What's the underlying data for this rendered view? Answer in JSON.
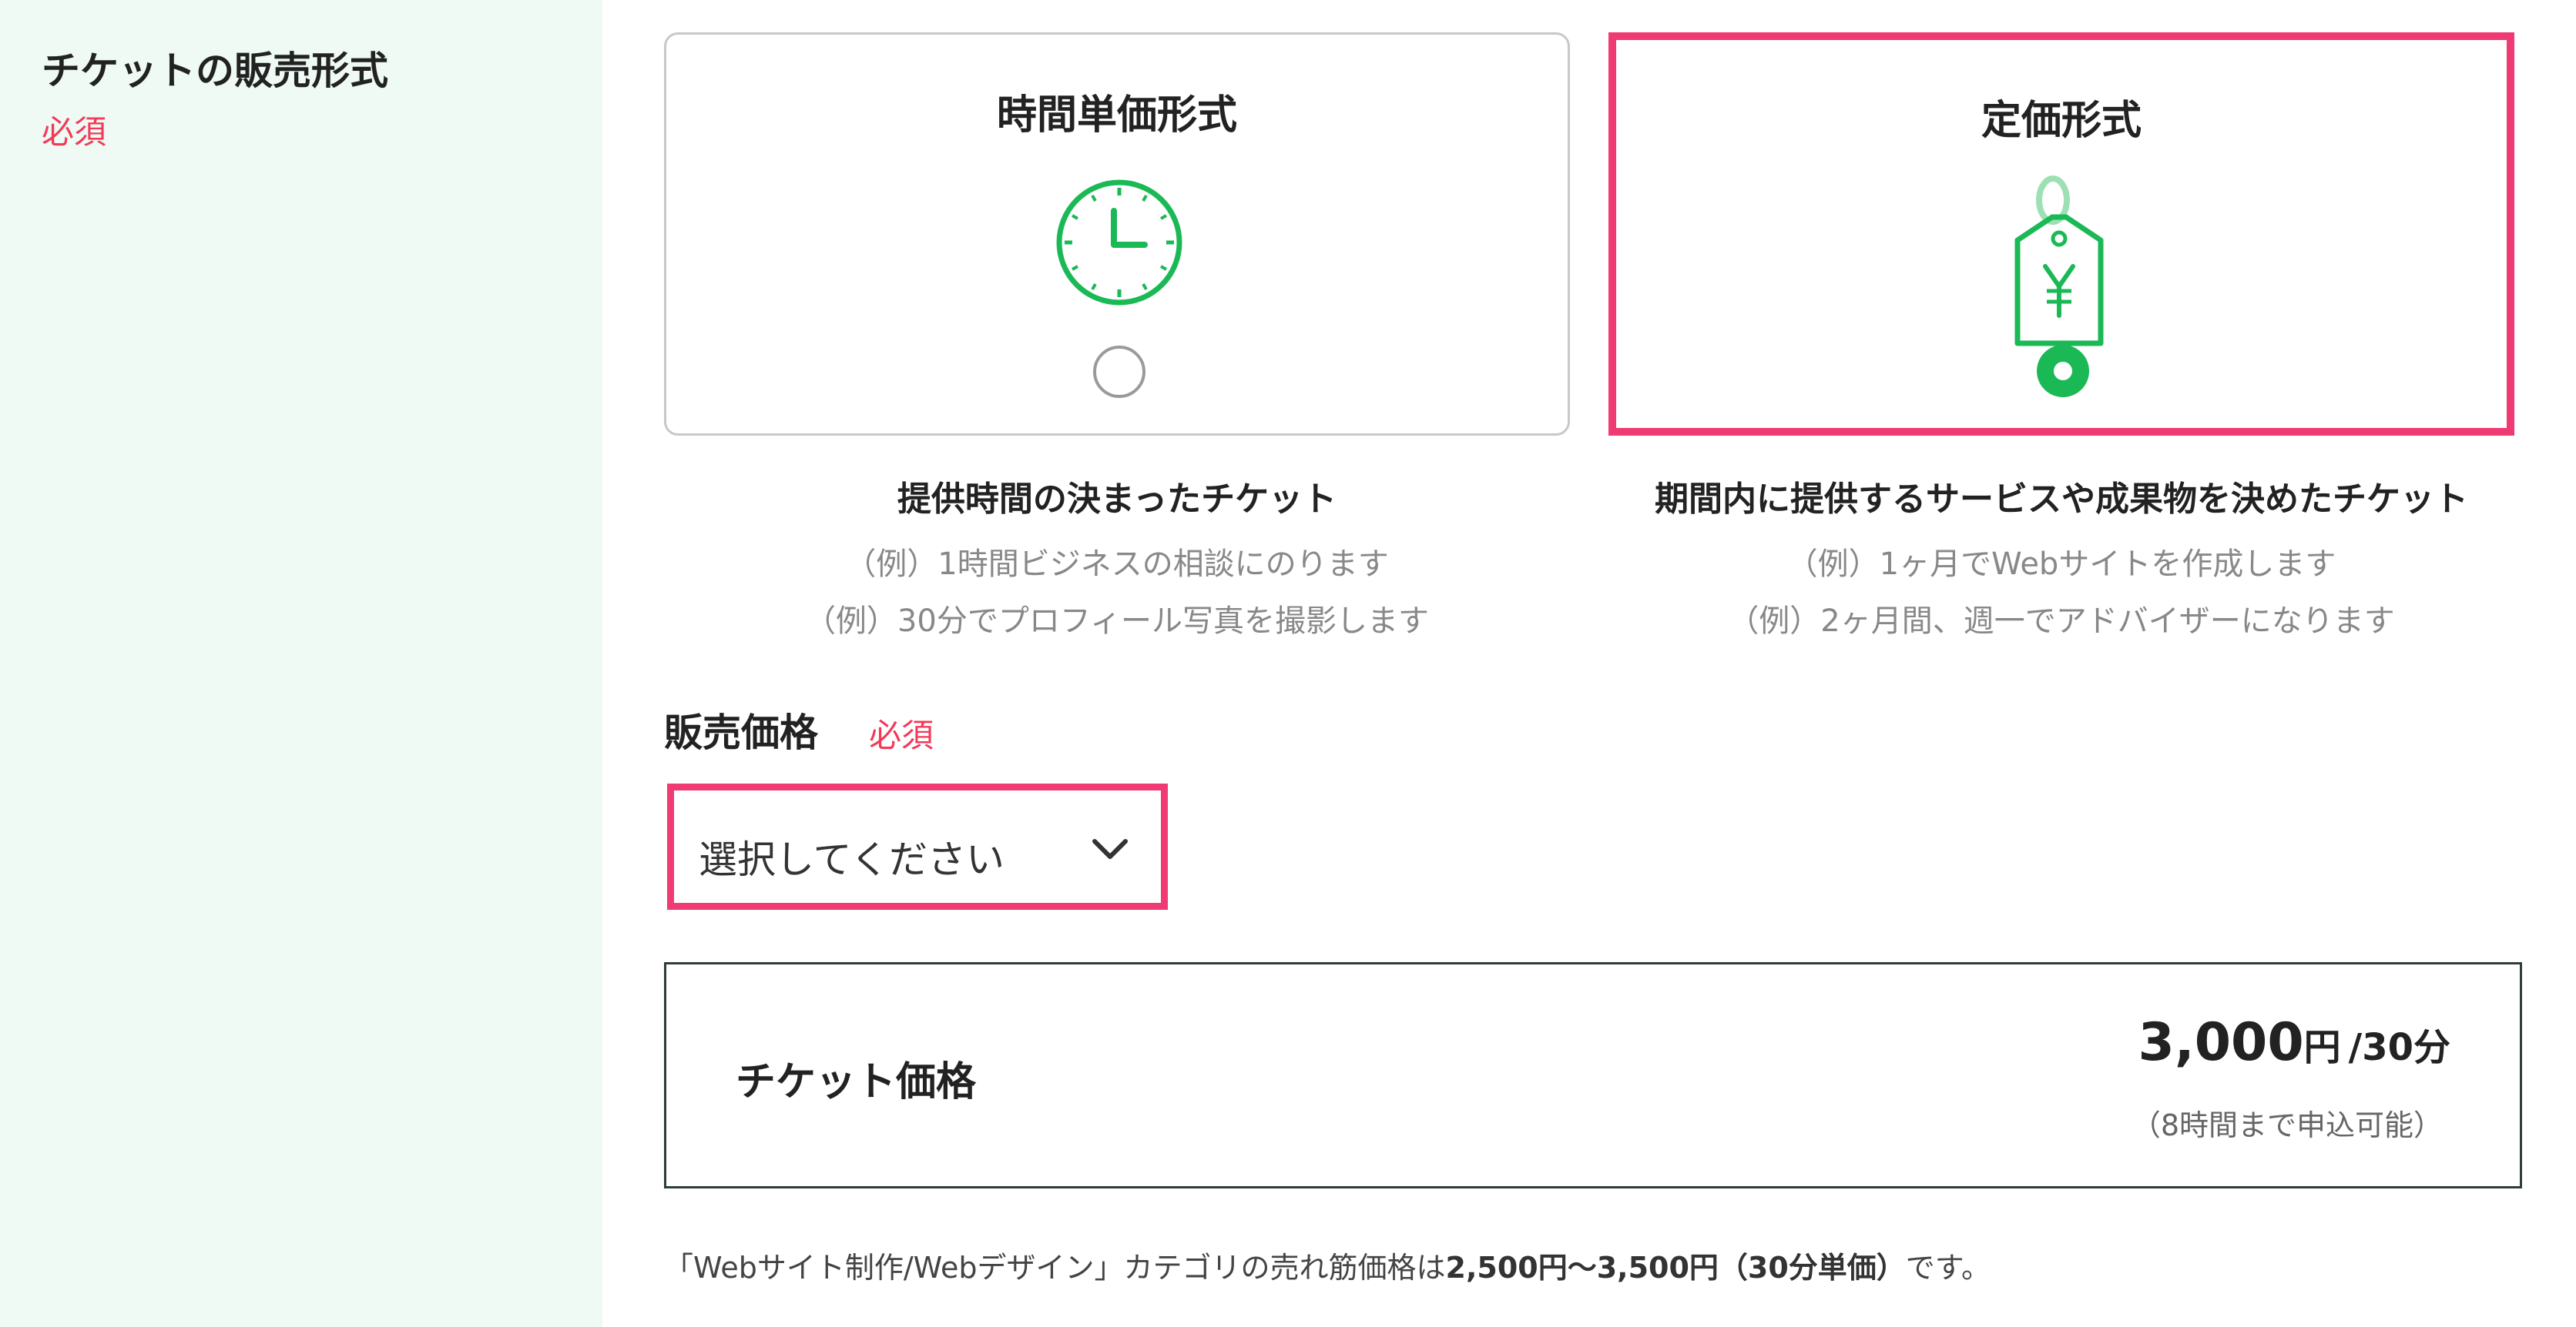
{
  "sidebar": {
    "field_title": "チケットの販売形式",
    "required": "必須"
  },
  "formats": {
    "hourly": {
      "title": "時間単価形式",
      "icon": "clock-icon",
      "selected": false,
      "description": "提供時間の決まったチケット",
      "examples": [
        "（例）1時間ビジネスの相談にのります",
        "（例）30分でプロフィール写真を撮影します"
      ]
    },
    "fixed": {
      "title": "定価形式",
      "icon": "price-tag-yen-icon",
      "selected": true,
      "description": "期間内に提供するサービスや成果物を決めたチケット",
      "examples": [
        "（例）1ヶ月でWebサイトを作成します",
        "（例）2ヶ月間、週一でアドバイザーになります"
      ]
    }
  },
  "price": {
    "label": "販売価格",
    "required": "必須",
    "select_placeholder": "選択してください"
  },
  "ticket": {
    "label": "チケット価格",
    "amount": "3,000",
    "currency": "円",
    "unit": "/30分",
    "note": "（8時間まで申込可能）"
  },
  "footer_note": {
    "prefix": "「Webサイト制作/Webデザイン」カテゴリの売れ筋価格は",
    "range": "2,500円〜3,500円（30分単価）",
    "suffix": "です。"
  },
  "colors": {
    "accent_green": "#1bb955",
    "highlight_pink": "#f03a73",
    "required_red": "#f23a58",
    "sidebar_bg": "#eefaf3"
  }
}
